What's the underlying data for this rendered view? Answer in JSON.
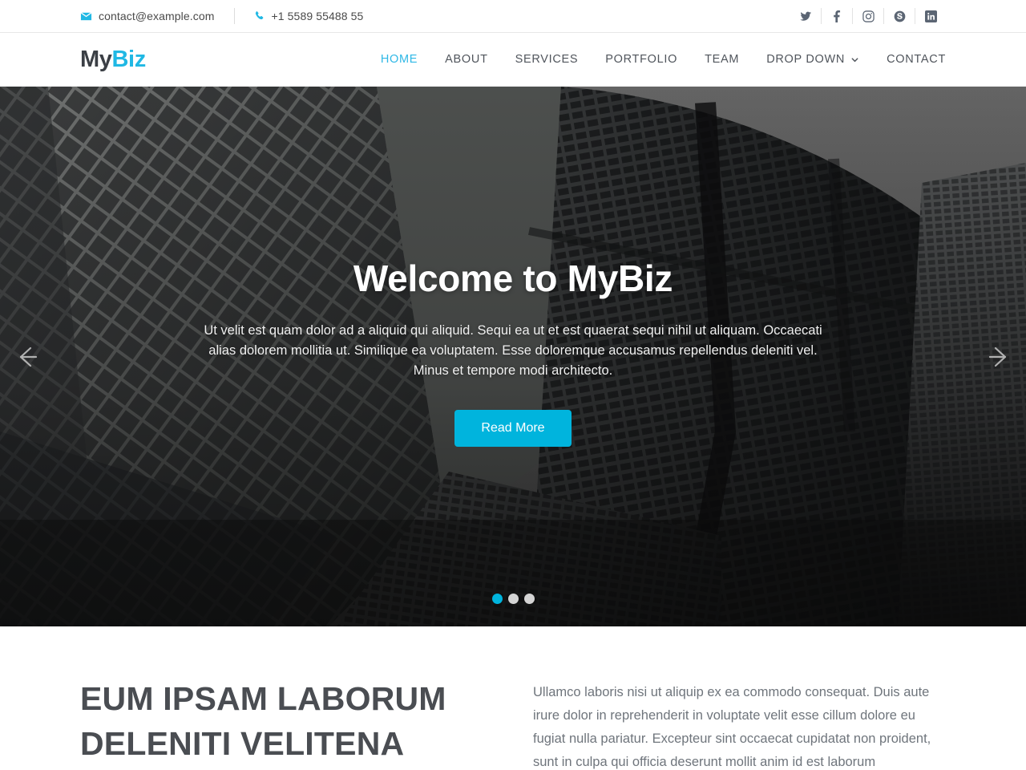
{
  "topbar": {
    "email": "contact@example.com",
    "phone": "+1 5589 55488 55",
    "email_icon": "envelope-icon",
    "phone_icon": "phone-icon",
    "socials": [
      {
        "name": "twitter",
        "label": "Twitter"
      },
      {
        "name": "facebook",
        "label": "Facebook"
      },
      {
        "name": "instagram",
        "label": "Instagram"
      },
      {
        "name": "skype",
        "label": "Skype"
      },
      {
        "name": "linkedin",
        "label": "LinkedIn"
      }
    ]
  },
  "header": {
    "logo_primary": "My",
    "logo_accent": "Biz",
    "nav": [
      {
        "label": "HOME",
        "active": true
      },
      {
        "label": "ABOUT",
        "active": false
      },
      {
        "label": "SERVICES",
        "active": false
      },
      {
        "label": "PORTFOLIO",
        "active": false
      },
      {
        "label": "TEAM",
        "active": false
      },
      {
        "label": "DROP DOWN",
        "active": false,
        "has_dropdown": true
      },
      {
        "label": "CONTACT",
        "active": false
      }
    ]
  },
  "hero": {
    "title": "Welcome to MyBiz",
    "description": "Ut velit est quam dolor ad a aliquid qui aliquid. Sequi ea ut et est quaerat sequi nihil ut aliquam. Occaecati alias dolorem mollitia ut. Similique ea voluptatem. Esse doloremque accusamus repellendus deleniti vel. Minus et tempore modi architecto.",
    "cta_label": "Read More",
    "prev_label": "Previous slide",
    "next_label": "Next slide",
    "slides": 3,
    "active_slide": 1,
    "background": "grayscale photograph of modern skyscrapers viewed from below"
  },
  "about": {
    "heading": "EUM IPSAM LABORUM DELENITI VELITENA",
    "body": "Ullamco laboris nisi ut aliquip ex ea commodo consequat. Duis aute irure dolor in reprehenderit in voluptate velit esse cillum dolore eu fugiat nulla pariatur. Excepteur sint occaecat cupidatat non proident, sunt in culpa qui officia deserunt mollit anim id est laborum"
  },
  "colors": {
    "accent": "#00b4dd",
    "nav_active": "#2fb8e6",
    "logo_dark": "#3b3f45",
    "text_muted": "#6f757c",
    "heading": "#4a4d52"
  }
}
